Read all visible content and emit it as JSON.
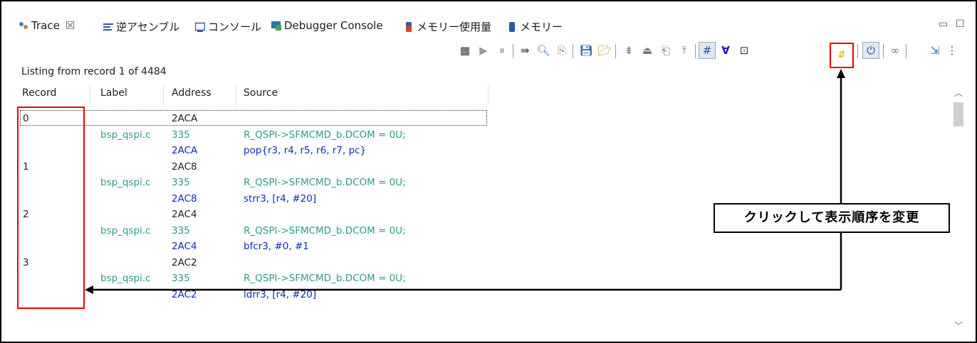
{
  "tabs": [
    {
      "label": "Trace",
      "icon": "trace-icon",
      "close": "☒"
    },
    {
      "label": "逆アセンブル",
      "icon": "disassembly-icon"
    },
    {
      "label": "コンソール",
      "icon": "console-icon"
    },
    {
      "label": "Debugger Console",
      "icon": "debugger-console-icon"
    },
    {
      "label": "メモリー使用量",
      "icon": "memory-usage-icon"
    },
    {
      "label": "メモリー",
      "icon": "memory-icon"
    }
  ],
  "window_controls": {
    "minimize": "▭",
    "maximize": "☐"
  },
  "listing_text": "Listing from record 1 of 4484",
  "columns": [
    "Record",
    "Label",
    "Address",
    "Source"
  ],
  "rows": [
    {
      "record": "0",
      "label": "",
      "address": "2ACA",
      "source": "",
      "kind": "rec"
    },
    {
      "record": "",
      "label": "bsp_qspi.c",
      "address": "335",
      "source": "R_QSPI->SFMCMD_b.DCOM = 0U;",
      "kind": "src"
    },
    {
      "record": "",
      "label": "",
      "address": "2ACA",
      "source": "pop{r3, r4, r5, r6, r7, pc}",
      "kind": "asm"
    },
    {
      "record": "1",
      "label": "",
      "address": "2AC8",
      "source": "",
      "kind": "rec"
    },
    {
      "record": "",
      "label": "bsp_qspi.c",
      "address": "335",
      "source": "R_QSPI->SFMCMD_b.DCOM = 0U;",
      "kind": "src"
    },
    {
      "record": "",
      "label": "",
      "address": "2AC8",
      "source": "strr3, [r4, #20]",
      "kind": "asm"
    },
    {
      "record": "2",
      "label": "",
      "address": "2AC4",
      "source": "",
      "kind": "rec"
    },
    {
      "record": "",
      "label": "bsp_qspi.c",
      "address": "335",
      "source": "R_QSPI->SFMCMD_b.DCOM = 0U;",
      "kind": "src"
    },
    {
      "record": "",
      "label": "",
      "address": "2AC4",
      "source": "bfcr3, #0, #1",
      "kind": "asm"
    },
    {
      "record": "3",
      "label": "",
      "address": "2AC2",
      "source": "",
      "kind": "rec"
    },
    {
      "record": "",
      "label": "bsp_qspi.c",
      "address": "335",
      "source": "R_QSPI->SFMCMD_b.DCOM = 0U;",
      "kind": "src"
    },
    {
      "record": "",
      "label": "",
      "address": "2AC2",
      "source": "ldrr3, [r4, #20]",
      "kind": "asm"
    }
  ],
  "callout_text": "クリックして表示順序を変更",
  "colors": {
    "label": "#2d9a8c",
    "asm": "#0b2db5",
    "highlight": "#e00000"
  }
}
